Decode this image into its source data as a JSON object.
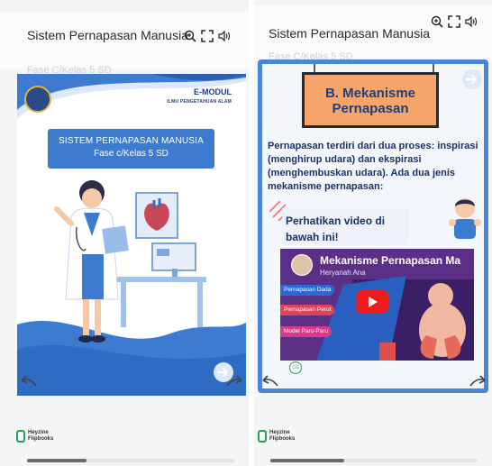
{
  "left": {
    "app_title": "Sistem Pernapasan Manusia",
    "subtitle_ghost": "Fase C/Kelas 5 SD",
    "cover": {
      "emodul": "E-MODUL",
      "subject": "ILMU PENGETAHUAN ALAM",
      "title_line1": "SISTEM PERNAPASAN MANUSIA",
      "title_line2": "Fase c/Kelas 5 SD"
    },
    "footer": {
      "brand_line1": "Heyzine",
      "brand_line2": "Flipbooks"
    }
  },
  "right": {
    "app_title": "Sistem Pernapasan Manusia",
    "subtitle_ghost": "Fase C/Kelas 5 SD",
    "page": {
      "heading_line1": "B. Mekanisme",
      "heading_line2": "Pernapasan",
      "paragraph": "Pernapasan terdiri dari dua proses: inspirasi (menghirup udara) dan ekspirasi (menghembuskan udara). Ada dua jenis mekanisme pernapasan:",
      "note_line1": "Perhatikan video di",
      "note_line2": "bawah ini!",
      "video": {
        "title": "Mekanisme Pernapasan Ma",
        "channel": "Heryanah Ana",
        "chips": [
          "Pernapasan Dada",
          "Pernapasan Perut",
          "Model Paru-Paru"
        ],
        "badge": "CG"
      }
    },
    "footer": {
      "brand_line1": "Heyzine",
      "brand_line2": "Flipbooks"
    }
  },
  "colors": {
    "accent_blue": "#3d7bd0",
    "board_orange": "#f6a56a",
    "heading_navy": "#1d3f7a",
    "video_purple": "#5b2f86",
    "play_red": "#ee1c1c",
    "heyzine_green": "#2e9e55"
  },
  "icons": [
    "zoom-in-icon",
    "fullscreen-icon",
    "sound-icon",
    "next-page-icon",
    "prev-page-icon",
    "heyzine-logo-icon"
  ]
}
